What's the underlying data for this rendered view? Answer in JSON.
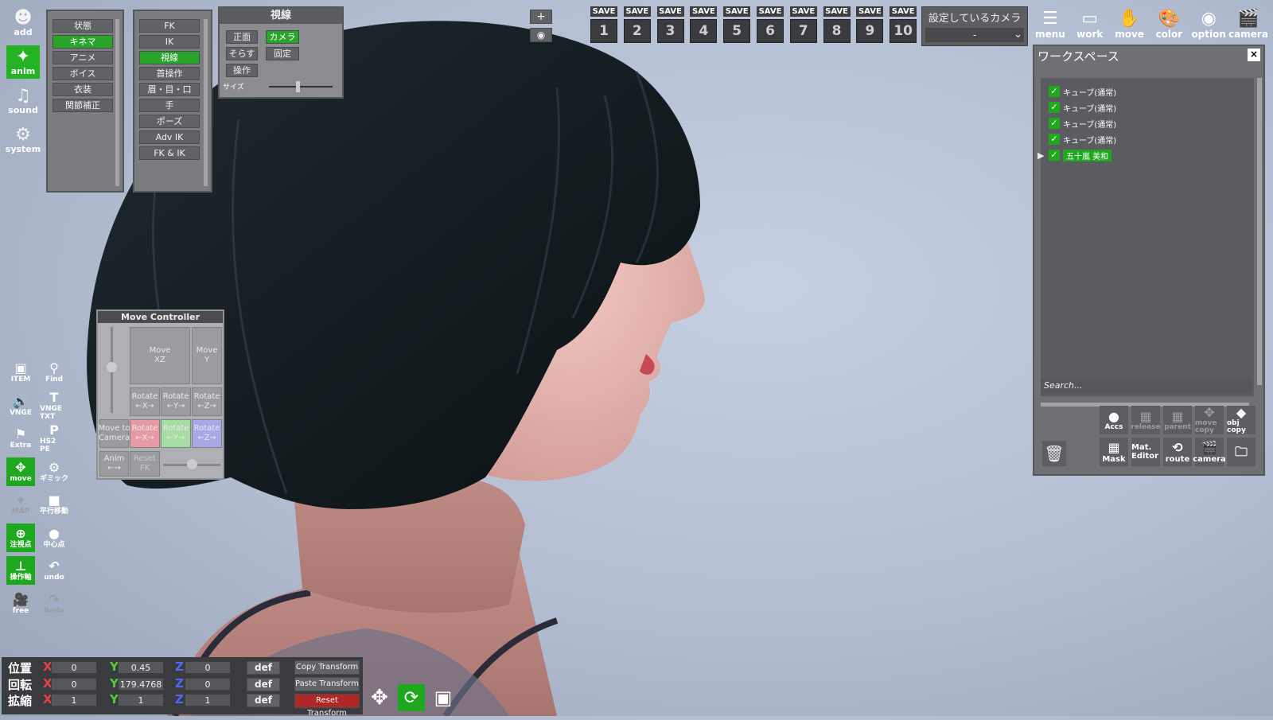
{
  "left_toolbar": {
    "add": "add",
    "anim": "anim",
    "sound": "sound",
    "system": "system"
  },
  "menu1": [
    "状態",
    "キネマ",
    "アニメ",
    "ボイス",
    "衣装",
    "関節補正"
  ],
  "menu1_active": "キネマ",
  "menu2": [
    "FK",
    "IK",
    "視線",
    "首操作",
    "眉・目・口",
    "手",
    "ポーズ",
    "Adv IK",
    "FK & IK"
  ],
  "menu2_active": "視線",
  "gaze_panel": {
    "title": "視線",
    "btn_front": "正面",
    "btn_camera": "カメラ",
    "btn_away": "そらす",
    "btn_fixed": "固定",
    "btn_operate": "操作",
    "size_label": "サイズ"
  },
  "view_controls": {
    "plus": "+"
  },
  "saves": {
    "label": "SAVE",
    "slots": [
      "1",
      "2",
      "3",
      "4",
      "5",
      "6",
      "7",
      "8",
      "9",
      "10"
    ]
  },
  "camera_select": {
    "title": "設定しているカメラ",
    "value": "-"
  },
  "top_icons": [
    "menu",
    "work",
    "move",
    "color",
    "option",
    "camera"
  ],
  "workspace": {
    "title": "ワークスペース",
    "items": [
      "キューブ(通常)",
      "キューブ(通常)",
      "キューブ(通常)",
      "キューブ(通常)",
      "五十嵐 美和"
    ],
    "search_placeholder": "Search...",
    "buttons_row1": [
      "Accs",
      "release",
      "parent",
      "move copy",
      "obj copy"
    ],
    "buttons_row2": [
      "Mask",
      "Mat. Editor",
      "route",
      "camera"
    ]
  },
  "move_controller": {
    "title": "Move Controller",
    "move_xz": "Move\nXZ",
    "move_y": "Move\nY",
    "rotate": "Rotate",
    "rx": "←X→",
    "ry": "←Y→",
    "rz": "←Z→",
    "move_to_camera": "Move to\nCamera",
    "anim": "Anim",
    "reset_fk": "Reset\nFK"
  },
  "side_tools": [
    [
      "ITEM",
      "item-icon"
    ],
    [
      "Find",
      "find-icon"
    ],
    [
      "VNGE",
      "vnge-icon"
    ],
    [
      "VNGE TXT",
      "txt-icon"
    ],
    [
      "Extra",
      "extra-icon"
    ],
    [
      "HS2 PE",
      "pe-icon"
    ],
    [
      "move",
      "move-icon"
    ],
    [
      "ギミック",
      "gimmick-icon"
    ],
    [
      "MAP",
      "map-icon"
    ],
    [
      "平行移動",
      "translate-icon"
    ],
    [
      "注視点",
      "target-icon"
    ],
    [
      "中心点",
      "center-icon"
    ],
    [
      "操作軸",
      "axis-icon"
    ],
    [
      "undo",
      "undo-icon"
    ],
    [
      "free",
      "free-icon"
    ],
    [
      "Redo",
      "redo-icon"
    ]
  ],
  "transform": {
    "labels": [
      "位置",
      "回転",
      "拡縮"
    ],
    "pos": {
      "x": "0",
      "y": "0.45",
      "z": "0"
    },
    "rot": {
      "x": "0",
      "y": "179.4768",
      "z": "0"
    },
    "scale": {
      "x": "1",
      "y": "1",
      "z": "1"
    },
    "def": "def",
    "copy": "Copy Transform",
    "paste": "Paste Transform",
    "reset": "Reset Transform"
  },
  "colors": {
    "accent": "#2aa52c",
    "panel": "#7a7c80",
    "dark": "#3a3b3e",
    "reset": "#b02727"
  }
}
